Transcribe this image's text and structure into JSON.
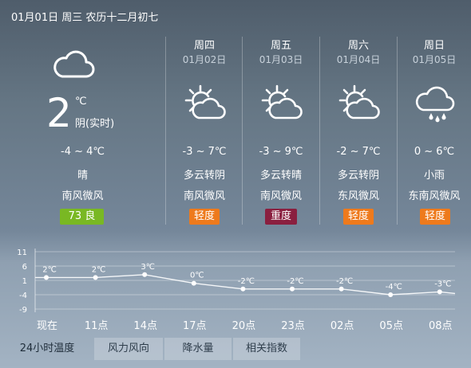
{
  "header": {
    "date_line": "01月01日 周三 农历十二月初七"
  },
  "today": {
    "icon": "cloudy-icon",
    "temp": "2",
    "unit": "℃",
    "condition": "阴(实时)",
    "range": "-4 ~ 4℃",
    "weather": "晴",
    "wind": "南风微风",
    "aqi": "73 良",
    "aqi_color": "#79b823"
  },
  "forecast": [
    {
      "day": "周四",
      "date": "01月02日",
      "icon": "partly-cloudy-icon",
      "range": "-3 ~ 7℃",
      "weather": "多云转阴",
      "wind": "南风微风",
      "aqi": "轻度",
      "aqi_color": "#ee7a1c"
    },
    {
      "day": "周五",
      "date": "01月03日",
      "icon": "partly-cloudy-icon",
      "range": "-3 ~ 9℃",
      "weather": "多云转晴",
      "wind": "南风微风",
      "aqi": "重度",
      "aqi_color": "#8a1f3f"
    },
    {
      "day": "周六",
      "date": "01月04日",
      "icon": "partly-cloudy-icon",
      "range": "-2 ~ 7℃",
      "weather": "多云转阴",
      "wind": "东风微风",
      "aqi": "轻度",
      "aqi_color": "#ee7a1c"
    },
    {
      "day": "周日",
      "date": "01月05日",
      "icon": "light-rain-icon",
      "range": "0 ~ 6℃",
      "weather": "小雨",
      "wind": "东南风微风",
      "aqi": "轻度",
      "aqi_color": "#ee7a1c"
    }
  ],
  "chart_data": {
    "type": "line",
    "title": "",
    "xlabel": "",
    "ylabel": "",
    "categories": [
      "现在",
      "11点",
      "14点",
      "17点",
      "20点",
      "23点",
      "02点",
      "05点",
      "08点"
    ],
    "values": [
      2,
      2,
      3,
      0,
      -2,
      -2,
      -2,
      -4,
      -3
    ],
    "point_labels": [
      "2℃",
      "2℃",
      "3℃",
      "0℃",
      "-2℃",
      "-2℃",
      "-2℃",
      "-4℃",
      "-3℃"
    ],
    "y_ticks": [
      11,
      6,
      1,
      -4,
      -9
    ],
    "ylim": [
      -9,
      11
    ],
    "grid": true
  },
  "tabs": [
    {
      "label": "24小时温度",
      "active": true
    },
    {
      "label": "风力风向",
      "active": false
    },
    {
      "label": "降水量",
      "active": false
    },
    {
      "label": "相关指数",
      "active": false
    }
  ]
}
